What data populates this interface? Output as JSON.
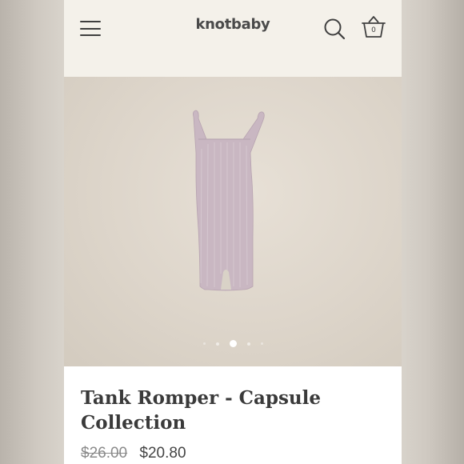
{
  "store": {
    "logo_text": "knotbaby"
  },
  "header": {
    "menu_icon": "hamburger-menu-icon",
    "search_icon": "search-icon",
    "cart_icon": "basket-icon",
    "cart_count": "0"
  },
  "gallery": {
    "image_subject": "lavender ribbed tank romper",
    "slide_count": 5,
    "active_slide": 3
  },
  "product": {
    "title": "Tank Romper - Capsule Collection",
    "original_price": "$26.00",
    "sale_price": "$20.80"
  },
  "colors": {
    "header_bg": "#f4f1ea",
    "image_bg": "#ddd5ca",
    "romper": "#c9b7c2",
    "text": "#3a3a3a"
  }
}
